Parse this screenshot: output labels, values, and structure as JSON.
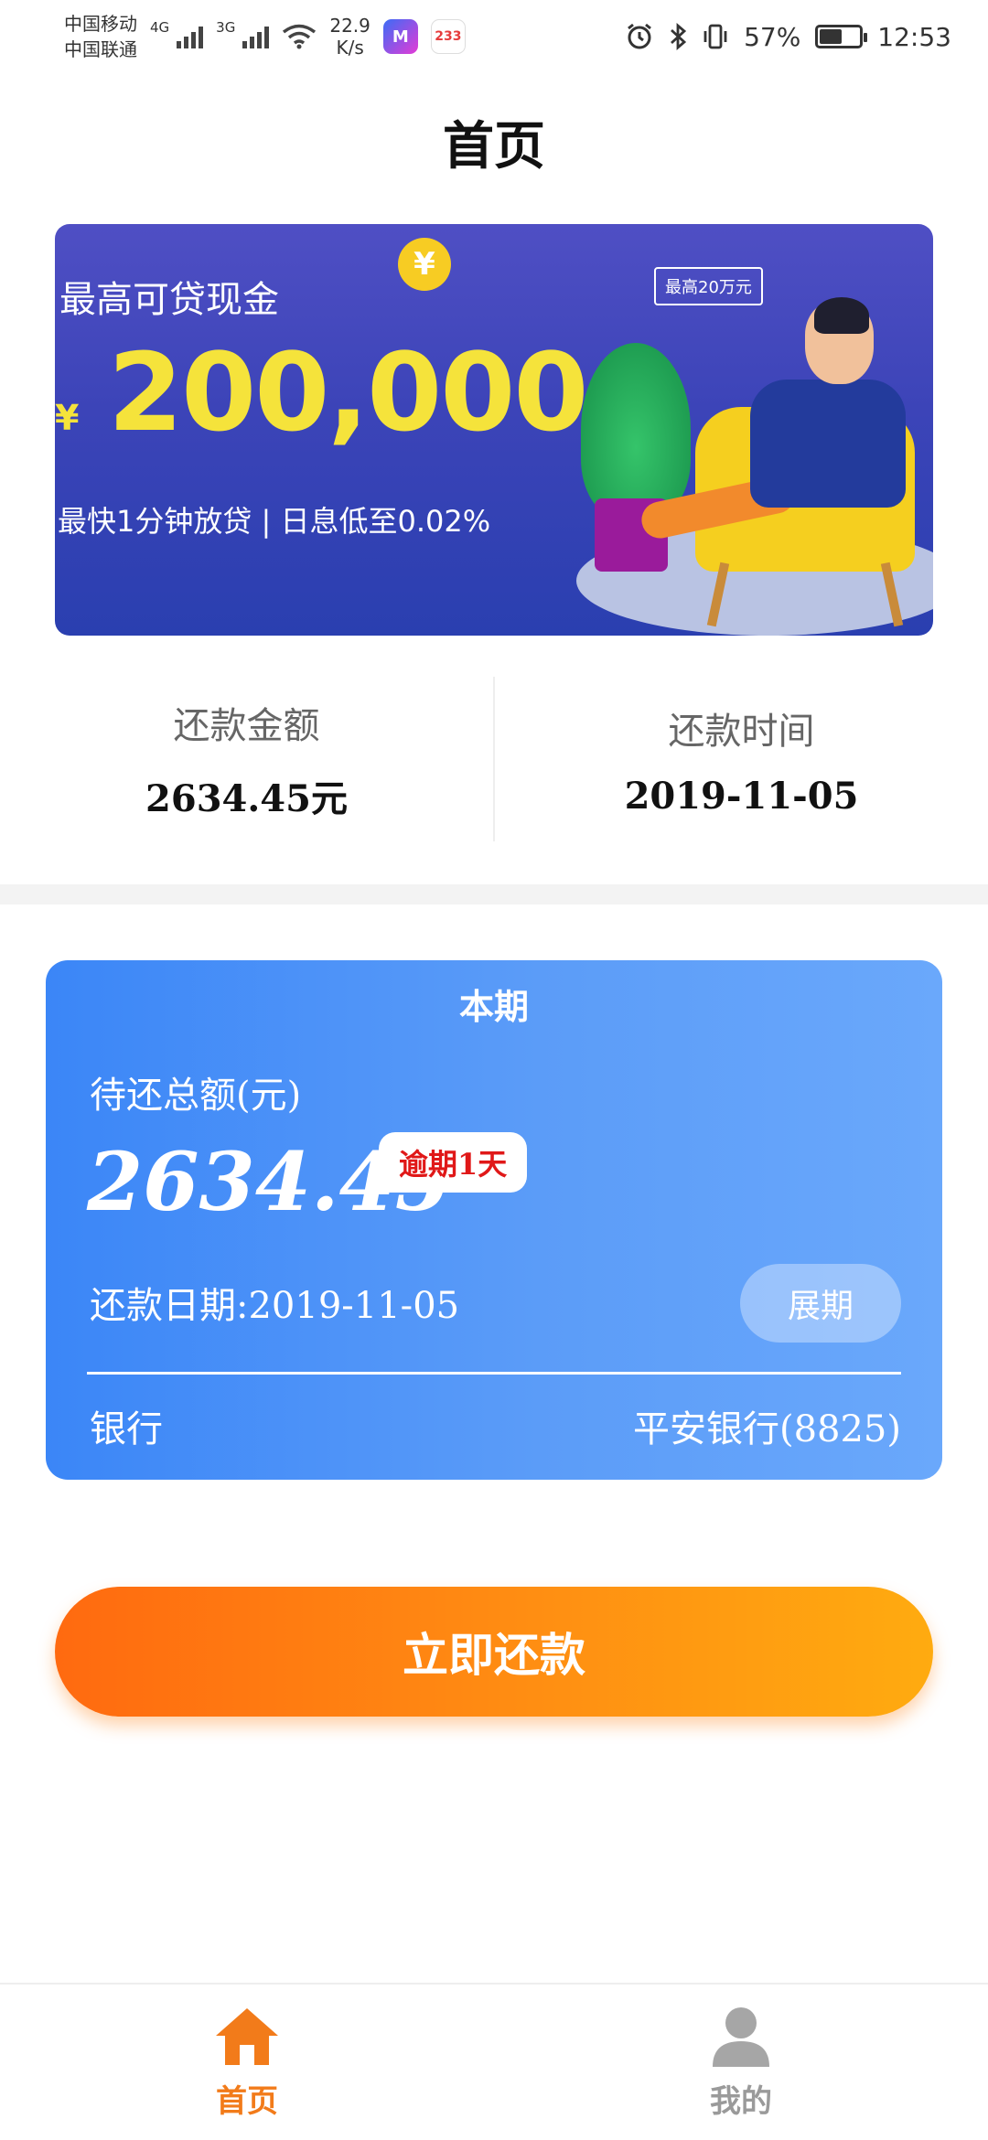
{
  "status_bar": {
    "carrier1": "中国移动",
    "carrier2": "中国联通",
    "net1": "4G",
    "net2": "3G",
    "speed_value": "22.9",
    "speed_unit": "K/s",
    "app_badge": "233",
    "battery": "57%",
    "battery_level": 0.57,
    "time": "12:53"
  },
  "page": {
    "title": "首页"
  },
  "banner": {
    "headline": "最高可贷现金",
    "currency": "¥",
    "amount": "200,000",
    "subline": "最快1分钟放贷 | 日息低至0.02%",
    "bubble": "最高20万元",
    "coin": "¥"
  },
  "summary": {
    "repay_amount_label": "还款金额",
    "repay_amount_value": "2634.45元",
    "repay_time_label": "还款时间",
    "repay_time_value": "2019-11-05"
  },
  "bill": {
    "period": "本期",
    "due_label": "待还总额(元)",
    "due_amount": "2634.45",
    "overdue_badge": "逾期1天",
    "due_date": "还款日期:2019-11-05",
    "extend_button": "展期",
    "bank_label": "银行",
    "bank_value": "平安银行(8825)"
  },
  "actions": {
    "repay_now": "立即还款"
  },
  "tabbar": {
    "home": "首页",
    "mine": "我的"
  },
  "colors": {
    "accent": "#f27b1a",
    "card_blue": "#3b86f7",
    "overdue_red": "#e01818"
  }
}
